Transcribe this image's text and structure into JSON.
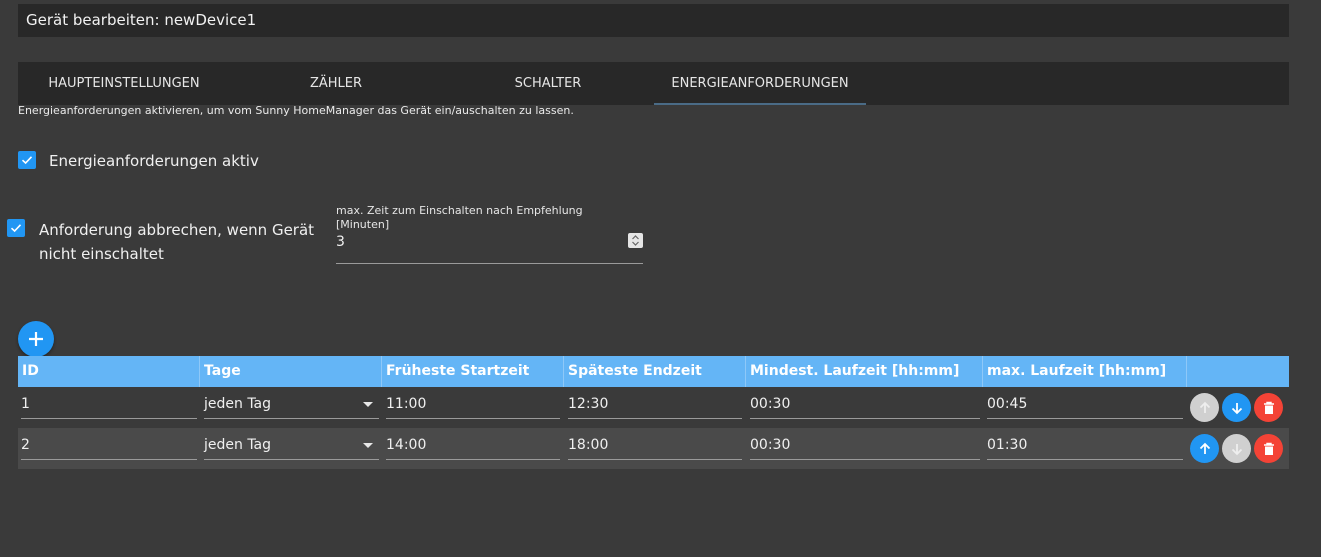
{
  "title": "Gerät bearbeiten: newDevice1",
  "tabs": [
    {
      "label": "Haupteinstellungen"
    },
    {
      "label": "Zähler"
    },
    {
      "label": "Schalter"
    },
    {
      "label": "Energieanforderungen"
    }
  ],
  "active_tab": 3,
  "hint": "Energieanforderungen aktivieren, um vom Sunny HomeManager das Gerät ein/auschalten zu lassen.",
  "checkbox_active": {
    "label": "Energieanforderungen aktiv",
    "checked": true
  },
  "checkbox_cancel": {
    "label_line1": "Anforderung abbrechen, wenn Gerät",
    "label_line2": "nicht einschaltet",
    "checked": true
  },
  "max_time": {
    "label_line1": "max. Zeit zum Einschalten nach Empfehlung",
    "label_line2": "[Minuten]",
    "value": "3"
  },
  "table": {
    "headers": [
      "ID",
      "Tage",
      "Früheste Startzeit",
      "Späteste Endzeit",
      "Mindest. Laufzeit [hh:mm]",
      "max. Laufzeit [hh:mm]"
    ],
    "rows": [
      {
        "id": "1",
        "days": "jeden Tag",
        "start": "11:00",
        "end": "12:30",
        "min_runtime": "00:30",
        "max_runtime": "00:45",
        "up_enabled": false,
        "down_enabled": true
      },
      {
        "id": "2",
        "days": "jeden Tag",
        "start": "14:00",
        "end": "18:00",
        "min_runtime": "00:30",
        "max_runtime": "01:30",
        "up_enabled": true,
        "down_enabled": false
      }
    ]
  },
  "colors": {
    "accent": "#2196f3",
    "header": "#64b5f6",
    "delete": "#f44336",
    "disabled": "#d0d0d0"
  },
  "icons": [
    "add-icon",
    "check-icon",
    "arrow-up-icon",
    "arrow-down-icon",
    "delete-icon"
  ]
}
